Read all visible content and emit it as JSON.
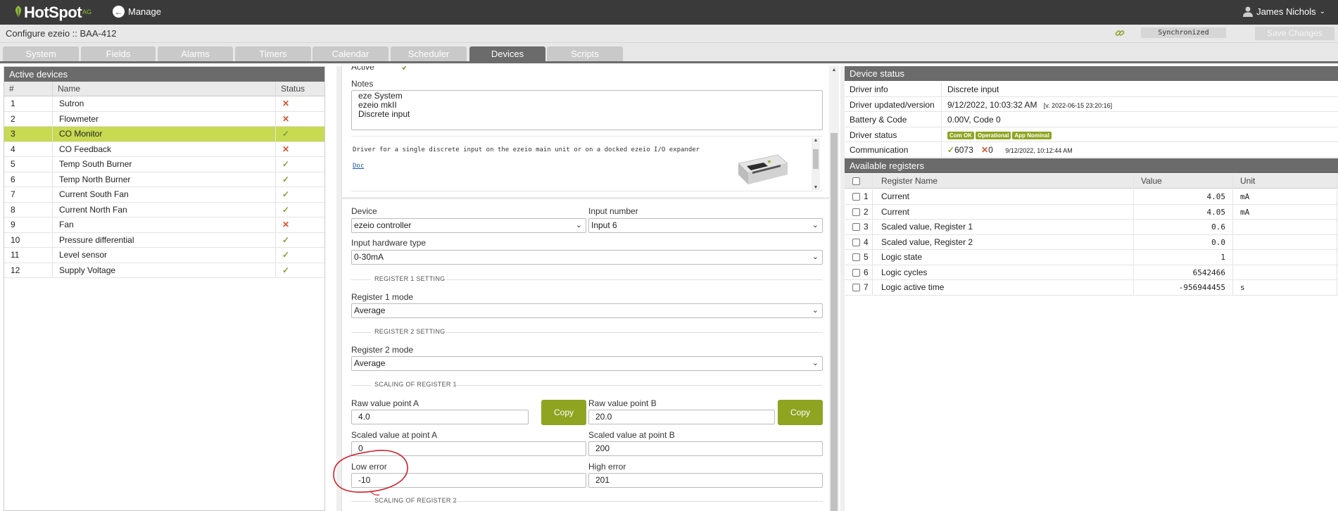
{
  "topbar": {
    "logo_text": "HotSpot",
    "logo_sub": "AG",
    "manage_label": "Manage",
    "user_name": "James Nichols"
  },
  "config": {
    "title": "Configure ezeio :: BAA-412",
    "sync_status": "Synchronized",
    "save_label": "Save Changes"
  },
  "tabs": [
    {
      "label": "System"
    },
    {
      "label": "Fields"
    },
    {
      "label": "Alarms"
    },
    {
      "label": "Timers"
    },
    {
      "label": "Calendar"
    },
    {
      "label": "Scheduler"
    },
    {
      "label": "Devices",
      "active": true
    },
    {
      "label": "Scripts"
    }
  ],
  "devices": {
    "title": "Active devices",
    "columns": [
      "#",
      "Name",
      "Status"
    ],
    "rows": [
      {
        "num": "1",
        "name": "Sutron",
        "status": "error"
      },
      {
        "num": "2",
        "name": "Flowmeter",
        "status": "error"
      },
      {
        "num": "3",
        "name": "CO Monitor",
        "status": "ok",
        "selected": true
      },
      {
        "num": "4",
        "name": "CO Feedback",
        "status": "error"
      },
      {
        "num": "5",
        "name": "Temp South Burner",
        "status": "ok"
      },
      {
        "num": "6",
        "name": "Temp North Burner",
        "status": "ok"
      },
      {
        "num": "7",
        "name": "Current South Fan",
        "status": "ok"
      },
      {
        "num": "8",
        "name": "Current North Fan",
        "status": "ok"
      },
      {
        "num": "9",
        "name": "Fan",
        "status": "error"
      },
      {
        "num": "10",
        "name": "Pressure differential",
        "status": "ok"
      },
      {
        "num": "11",
        "name": "Level sensor",
        "status": "ok"
      },
      {
        "num": "12",
        "name": "Supply Voltage",
        "status": "ok"
      }
    ]
  },
  "form": {
    "active_label": "Active",
    "notes_label": "Notes",
    "notes_lines": [
      "eze System",
      "ezeio mkII",
      "Discrete input"
    ],
    "description": "Driver for a single discrete input on the ezeio main unit or on a docked ezeio I/O expander",
    "doc_link": "Doc",
    "device_label": "Device",
    "device_value": "ezeio controller",
    "input_number_label": "Input number",
    "input_number_value": "Input 6",
    "hw_type_label": "Input hardware type",
    "hw_type_value": "0-30mA",
    "section_reg1": "REGISTER 1 SETTING",
    "reg1_mode_label": "Register 1 mode",
    "reg1_mode_value": "Average",
    "section_reg2": "REGISTER 2 SETTING",
    "reg2_mode_label": "Register 2 mode",
    "reg2_mode_value": "Average",
    "section_scaling1": "SCALING OF REGISTER 1",
    "raw_a_label": "Raw value point A",
    "raw_a_value": "4.0",
    "raw_b_label": "Raw value point B",
    "raw_b_value": "20.0",
    "copy_label": "Copy",
    "scaled_a_label": "Scaled value at point A",
    "scaled_a_value": "0",
    "scaled_b_label": "Scaled value at point B",
    "scaled_b_value": "200",
    "low_error_label": "Low error",
    "low_error_value": "-10",
    "high_error_label": "High error",
    "high_error_value": "201",
    "section_scaling2": "SCALING OF REGISTER 2"
  },
  "status": {
    "title": "Device status",
    "driver_info_label": "Driver info",
    "driver_info_value": "Discrete input",
    "driver_updated_label": "Driver updated/version",
    "driver_updated_value": "9/12/2022, 10:03:32 AM",
    "driver_version": "[v. 2022-06-15 23:20:16]",
    "battery_label": "Battery & Code",
    "battery_value": "0.00V, Code 0",
    "driver_status_label": "Driver status",
    "badges": [
      "Com OK",
      "Operational",
      "App Nominal"
    ],
    "comm_label": "Communication",
    "comm_ok": "6073",
    "comm_err": "0",
    "comm_time": "9/12/2022, 10:12:44 AM"
  },
  "registers": {
    "title": "Available registers",
    "columns": [
      "Register Name",
      "Value",
      "Unit"
    ],
    "rows": [
      {
        "num": "1",
        "name": "Current",
        "value": "4.05",
        "unit": "mA"
      },
      {
        "num": "2",
        "name": "Current",
        "value": "4.05",
        "unit": "mA"
      },
      {
        "num": "3",
        "name": "Scaled value, Register 1",
        "value": "0.6",
        "unit": ""
      },
      {
        "num": "4",
        "name": "Scaled value, Register 2",
        "value": "0.0",
        "unit": ""
      },
      {
        "num": "5",
        "name": "Logic state",
        "value": "1",
        "unit": ""
      },
      {
        "num": "6",
        "name": "Logic cycles",
        "value": "6542466",
        "unit": ""
      },
      {
        "num": "7",
        "name": "Logic active time",
        "value": "-956944455",
        "unit": "s"
      }
    ]
  },
  "colors": {
    "accent_green": "#8fa421",
    "selected_row": "#c7da52",
    "ok": "#7aa536",
    "error": "#d9512c",
    "annotation": "#d4202a"
  }
}
